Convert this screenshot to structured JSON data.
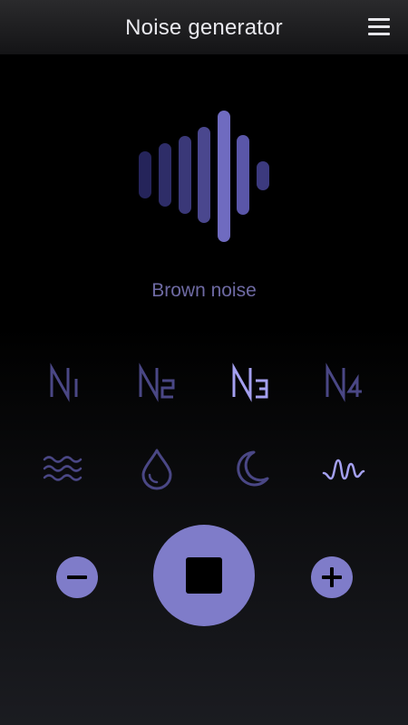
{
  "header": {
    "title": "Noise generator",
    "menu_icon": "hamburger-menu-icon"
  },
  "visualizer": {
    "icon": "sound-wave-icon",
    "accent": "#7f7cc9"
  },
  "current_noise": {
    "label": "Brown noise"
  },
  "presets": [
    {
      "label": "N",
      "sub": "1",
      "selected": false
    },
    {
      "label": "N",
      "sub": "2",
      "selected": false
    },
    {
      "label": "N",
      "sub": "3",
      "selected": true
    },
    {
      "label": "N",
      "sub": "4",
      "selected": false
    }
  ],
  "sounds": [
    {
      "icon": "waves-icon",
      "selected": false
    },
    {
      "icon": "water-drop-icon",
      "selected": false
    },
    {
      "icon": "moon-icon",
      "selected": false
    },
    {
      "icon": "noise-squiggle-icon",
      "selected": true
    }
  ],
  "controls": {
    "decrease_icon": "minus-icon",
    "main_icon": "stop-icon",
    "increase_icon": "plus-icon"
  },
  "colors": {
    "accent": "#7f7cc9",
    "dim": "#4a4785",
    "selected": "#a4a0f0",
    "label": "#6e6aa3"
  }
}
